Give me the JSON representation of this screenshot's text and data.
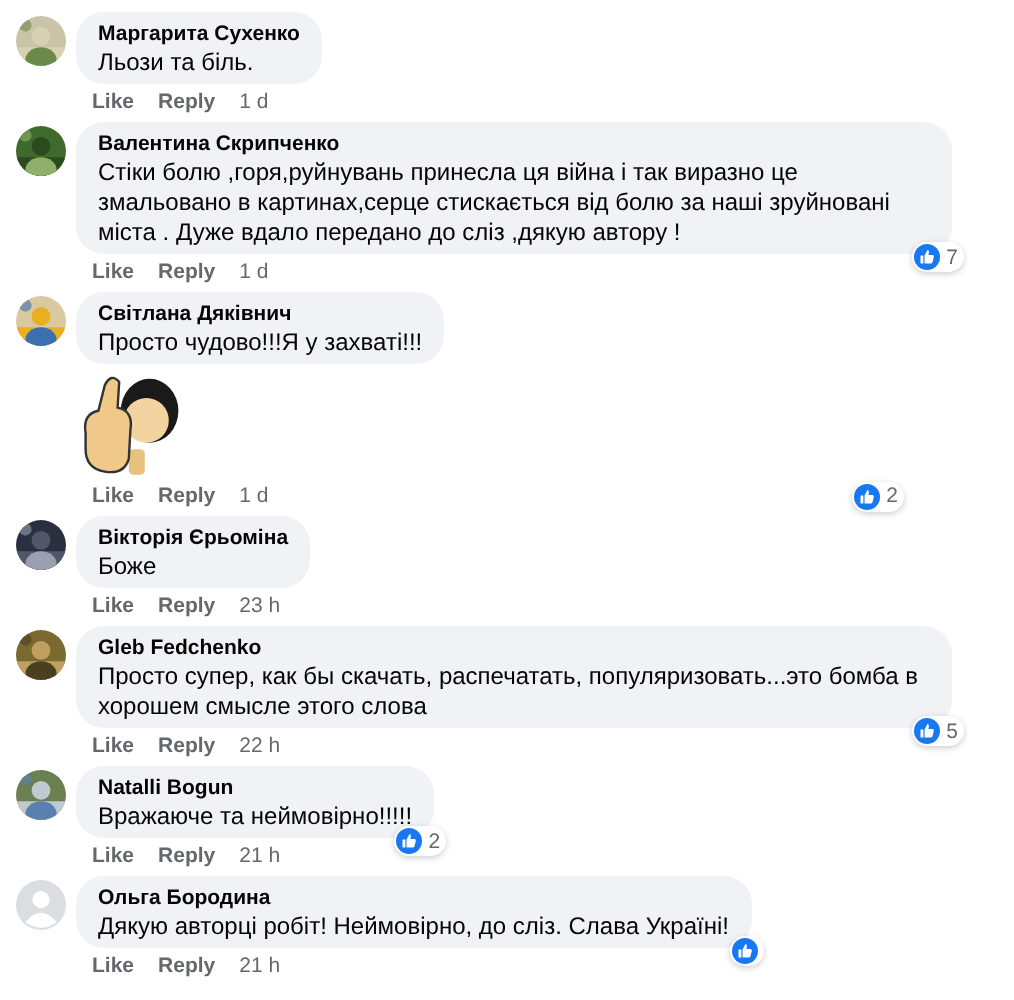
{
  "comments": [
    {
      "author": "Маргарита Сухенко",
      "text": "Льози та біль.",
      "kind": "text",
      "actions": [
        "Like",
        "Reply"
      ],
      "time": "1 d",
      "has_reaction": false
    },
    {
      "author": "Валентина Скрипченко",
      "text": "Стіки болю ,горя,руйнувань принесла ця війна і так виразно це змальовано в картинах,серце стискається від болю за наші зруйновані міста . Дуже вдало передано до сліз ,дякую автору !",
      "kind": "text",
      "actions": [
        "Like",
        "Reply"
      ],
      "time": "1 d",
      "has_reaction": true,
      "reaction_count": "7"
    },
    {
      "author": "Світлана Дяківнич",
      "text": "Просто чудово!!!Я у захваті!!!",
      "kind": "sticker",
      "actions": [
        "Like",
        "Reply"
      ],
      "time": "1 d",
      "has_reaction": true,
      "reaction_count": "2"
    },
    {
      "author": "Вікторія Єрьоміна",
      "text": "Боже",
      "kind": "text",
      "actions": [
        "Like",
        "Reply"
      ],
      "time": "23 h",
      "has_reaction": false
    },
    {
      "author": "Gleb Fedchenko",
      "text": "Просто супер, как бы скачать, распечатать, популяризовать...это бомба в хорошем смысле этого слова",
      "kind": "text",
      "actions": [
        "Like",
        "Reply"
      ],
      "time": "22 h",
      "has_reaction": true,
      "reaction_count": "5"
    },
    {
      "author": "Natalli Bogun",
      "text": "Вражаюче та неймовірно!!!!!",
      "kind": "text",
      "actions": [
        "Like",
        "Reply"
      ],
      "time": "21 h",
      "has_reaction": true,
      "reaction_count": "2"
    },
    {
      "avatar": {
        "kind": "default"
      },
      "author": "Ольга Бородина",
      "text": "Дякую авторці робіт! Неймовірно, до сліз. Слава Україні!",
      "kind": "text",
      "actions": [
        "Like",
        "Reply"
      ],
      "time": "21 h",
      "has_reaction": true
    }
  ]
}
